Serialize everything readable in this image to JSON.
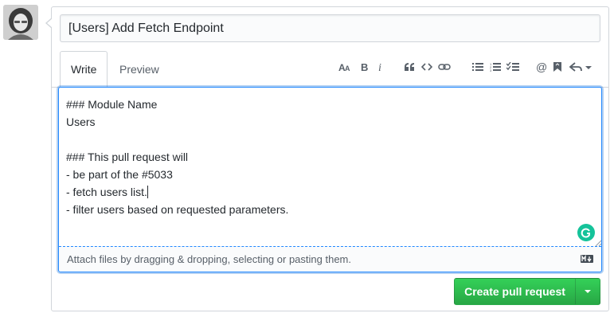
{
  "avatar": {
    "icon": "user-avatar-icon"
  },
  "pr_form": {
    "title_value": "[Users] Add Fetch Endpoint",
    "tabs": [
      {
        "label": "Write",
        "active": true
      },
      {
        "label": "Preview",
        "active": false
      }
    ],
    "toolbar_icons": [
      "text-size-icon",
      "bold-icon",
      "italic-icon",
      "quote-icon",
      "code-icon",
      "link-icon",
      "unordered-list-icon",
      "ordered-list-icon",
      "tasklist-icon",
      "mention-icon",
      "saved-replies-icon",
      "reply-icon"
    ],
    "body_lines": [
      "### Module Name",
      "Users",
      "",
      "### This pull request will",
      "- be part of the #5033",
      "- fetch users list.",
      "- filter users based on requested parameters."
    ],
    "attach_text": "Attach files by dragging & dropping, selecting or pasting them.",
    "markdown_badge": "markdown-icon",
    "submit_label": "Create pull request"
  },
  "colors": {
    "accent": "#2188ff",
    "button_green": "#28a745",
    "grammarly": "#15c39a"
  }
}
